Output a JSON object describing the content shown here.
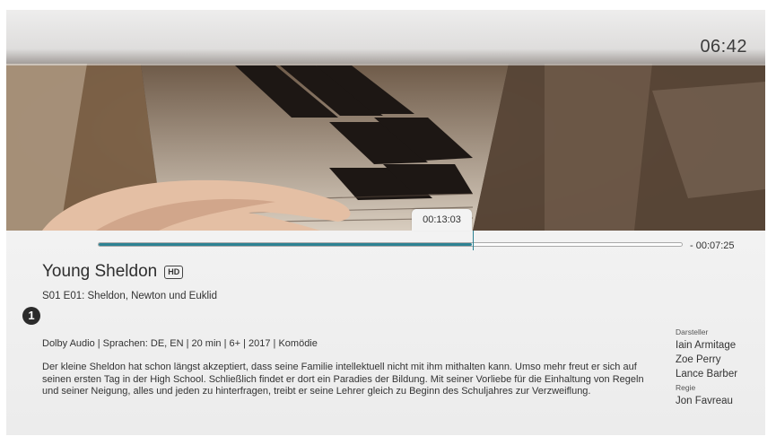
{
  "player": {
    "clock": "06:42",
    "position_time": "00:13:03",
    "remaining_time": "- 00:07:25",
    "progress_fraction": 0.64
  },
  "program": {
    "title": "Young Sheldon",
    "quality_badge": "HD",
    "episode": "S01 E01: Sheldon, Newton und Euklid",
    "number_badge": "1",
    "meta": "Dolby Audio | Sprachen: DE, EN | 20 min | 6+ | 2017 | Komödie",
    "description": "Der kleine Sheldon hat schon längst akzeptiert, dass seine Familie intellektuell nicht mit ihm mithalten kann. Umso mehr freut er sich auf seinen ersten Tag in der High School. Schließlich findet er dort ein Paradies der Bildung. Mit seiner Vorliebe für die Einhaltung von Regeln und seiner Neigung, alles und jeden zu hinterfragen, treibt er seine Lehrer gleich zu Beginn des Schuljahres zur Verzweiflung."
  },
  "credits": {
    "cast_label": "Darsteller",
    "cast": [
      "Iain Armitage",
      "Zoe Perry",
      "Lance Barber"
    ],
    "director_label": "Regie",
    "director": "Jon Favreau"
  },
  "colors": {
    "progress_fill": "#2d8293",
    "panel_bg": "#eeeeee"
  },
  "icons": {
    "video": "piano-keys-image"
  }
}
